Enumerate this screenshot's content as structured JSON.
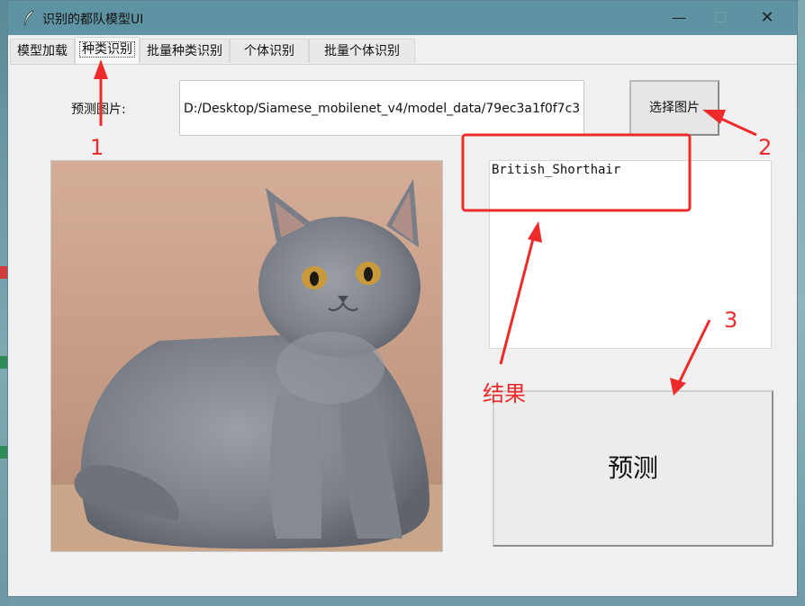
{
  "window": {
    "title": "识别的都队模型UI",
    "min_glyph": "—",
    "max_glyph": "☐",
    "close_glyph": "✕"
  },
  "tabs": [
    {
      "label": "模型加载"
    },
    {
      "label": "种类识别",
      "active": true
    },
    {
      "label": "批量种类识别"
    },
    {
      "label": "个体识别"
    },
    {
      "label": "批量个体识别"
    }
  ],
  "form": {
    "predict_image_label": "预测图片:",
    "image_path": "D:/Desktop/Siamese_mobilenet_v4/model_data/79ec3a1f0f7c3",
    "choose_button": "选择图片",
    "result_text": "British_Shorthair",
    "predict_button": "预测"
  },
  "annotations": {
    "num1": "1",
    "num2": "2",
    "num3": "3",
    "result_label": "结果",
    "color": "#ee2a2a"
  },
  "colors": {
    "titlebar": "#5d93a2",
    "window_bg": "#f0f0f0"
  }
}
